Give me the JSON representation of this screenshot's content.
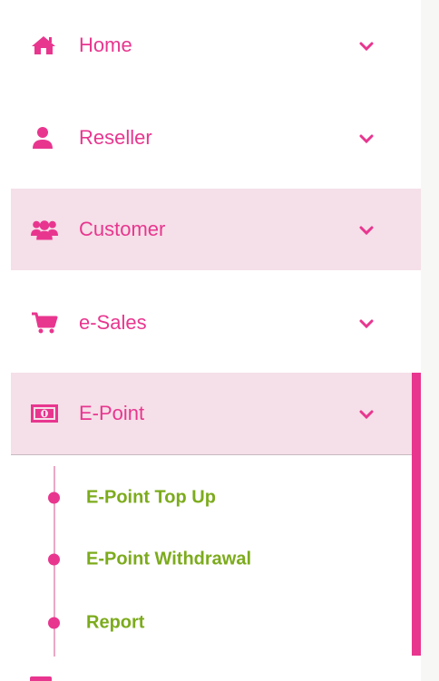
{
  "colors": {
    "accent": "#e8368f",
    "highlight_bg": "#f5dfe8",
    "submenu_text": "#7cab1c"
  },
  "menu": {
    "home": {
      "label": "Home",
      "icon": "home-icon"
    },
    "reseller": {
      "label": "Reseller",
      "icon": "user-icon"
    },
    "customer": {
      "label": "Customer",
      "icon": "users-icon"
    },
    "esales": {
      "label": "e-Sales",
      "icon": "cart-icon"
    },
    "epoint": {
      "label": "E-Point",
      "icon": "money-icon"
    }
  },
  "submenu": {
    "items": [
      {
        "label": "E-Point Top Up"
      },
      {
        "label": "E-Point Withdrawal"
      },
      {
        "label": "Report"
      }
    ]
  }
}
